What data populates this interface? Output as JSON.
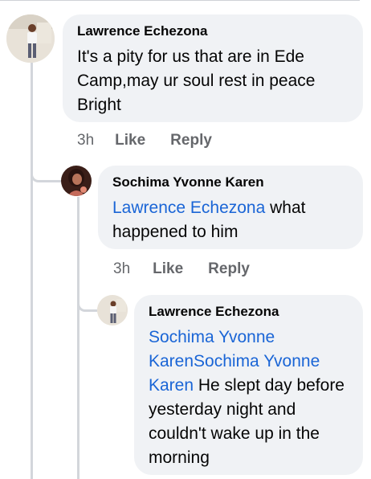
{
  "comments": [
    {
      "author": "Lawrence Echezona",
      "text": "It's a  pity for us that are in Ede Camp,may ur soul rest in peace Bright",
      "time": "3h",
      "like_label": "Like",
      "reply_label": "Reply"
    },
    {
      "author": "Sochima Yvonne Karen",
      "mention": "Lawrence Echezona",
      "text": " what happened to him",
      "time": "3h",
      "like_label": "Like",
      "reply_label": "Reply"
    },
    {
      "author": "Lawrence Echezona",
      "mention": "Sochima Yvonne KarenSochima Yvonne Karen",
      "text": " He slept day before yesterday night and couldn't wake up in the morning"
    }
  ],
  "colors": {
    "bubble": "#f0f2f5",
    "mention": "#1a65d6",
    "meta": "#65676b",
    "thread_line": "#d3d6db"
  }
}
